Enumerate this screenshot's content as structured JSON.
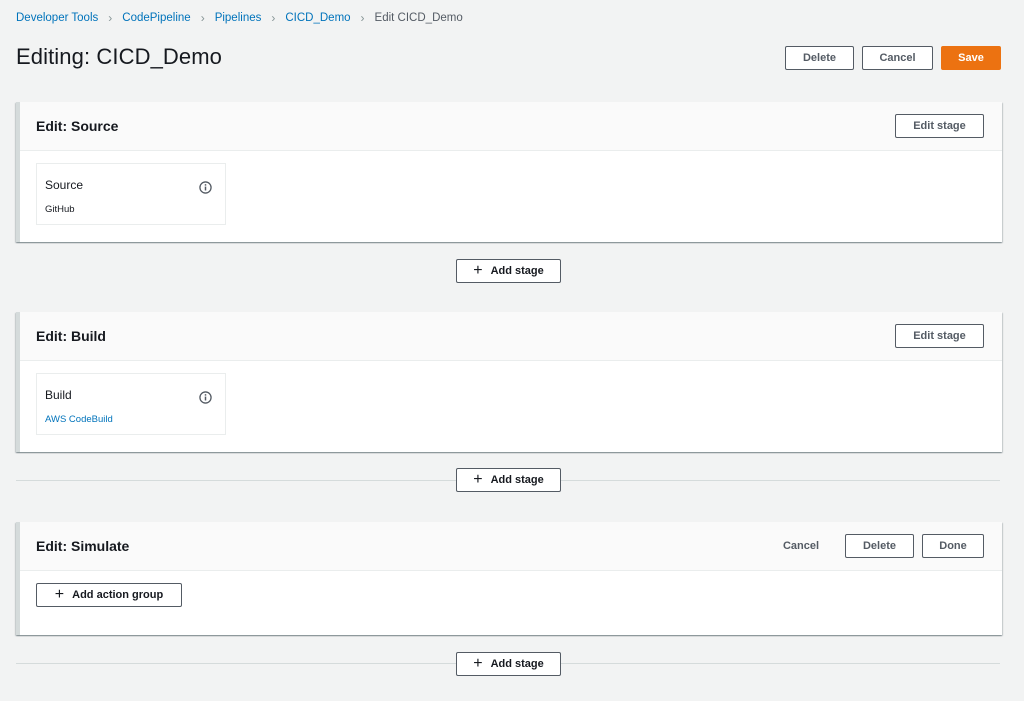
{
  "breadcrumb": [
    {
      "label": "Developer Tools",
      "link": true
    },
    {
      "label": "CodePipeline",
      "link": true
    },
    {
      "label": "Pipelines",
      "link": true
    },
    {
      "label": "CICD_Demo",
      "link": true
    },
    {
      "label": "Edit CICD_Demo",
      "link": false
    }
  ],
  "page": {
    "title": "Editing: CICD_Demo",
    "delete_label": "Delete",
    "cancel_label": "Cancel",
    "save_label": "Save"
  },
  "stages": {
    "source": {
      "title": "Edit: Source",
      "edit_label": "Edit stage",
      "action": {
        "name": "Source",
        "provider": "GitHub"
      }
    },
    "build": {
      "title": "Edit: Build",
      "edit_label": "Edit stage",
      "action": {
        "name": "Build",
        "provider": "AWS CodeBuild"
      }
    },
    "simulate": {
      "title": "Edit: Simulate",
      "cancel_label": "Cancel",
      "delete_label": "Delete",
      "done_label": "Done",
      "add_action_group_label": "Add action group"
    }
  },
  "add_stage_label": "Add stage",
  "icons": {
    "separator": "chevron-right-icon",
    "info": "info-icon",
    "add": "plus-icon"
  },
  "colors": {
    "link": "#0073bb",
    "primary": "#ec7211",
    "background": "#f2f3f3"
  }
}
